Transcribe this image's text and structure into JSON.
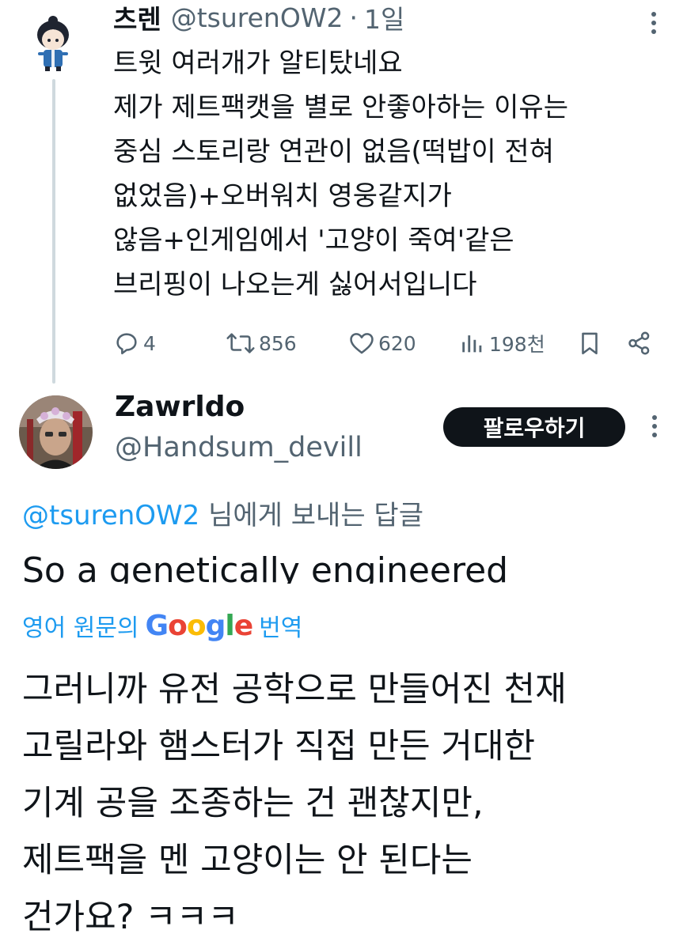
{
  "tweet": {
    "display_name": "츠렌",
    "handle": "@tsurenOW2",
    "separator": "·",
    "time": "1일",
    "text_lines": [
      "트윗 여러개가 알티탔네요",
      "제가 제트팩캣을 별로 안좋아하는 이유는",
      "중심 스토리랑 연관이 없음(떡밥이 전혀",
      "없었음)+오버워치 영웅같지가",
      "않음+인게임에서 '고양이 죽여'같은",
      "브리핑이 나오는게 싫어서입니다"
    ],
    "stats": {
      "replies": "4",
      "retweets": "856",
      "likes": "620",
      "views": "198천"
    },
    "icons": [
      "avatar-chibi",
      "more-icon",
      "reply-icon",
      "retweet-icon",
      "like-icon",
      "views-icon",
      "bookmark-icon",
      "share-icon"
    ]
  },
  "reply": {
    "display_name": "Zawrldo",
    "handle": "@Handsum_devill",
    "follow_label": "팔로우하기",
    "replying_to_mention": "@tsurenOW2",
    "replying_to_suffix": " 님에게 보내는 답글",
    "original_text_visible": "So a genetically engineered",
    "translation": {
      "label": "영어 원문의",
      "brand": "Google",
      "action": "번역"
    },
    "translated_lines": [
      "그러니까 유전 공학으로 만들어진 천재",
      "고릴라와 햄스터가 직접 만든 거대한",
      "기계 공을 조종하는 건 괜찮지만,",
      "제트팩을 멘 고양이는 안 된다는",
      "건가요? ㅋㅋㅋ"
    ]
  },
  "colors": {
    "text": "#0f1419",
    "secondary": "#536471",
    "link": "#1d9bf0",
    "thread_line": "#cfd9de",
    "button_bg": "#0f1419"
  }
}
